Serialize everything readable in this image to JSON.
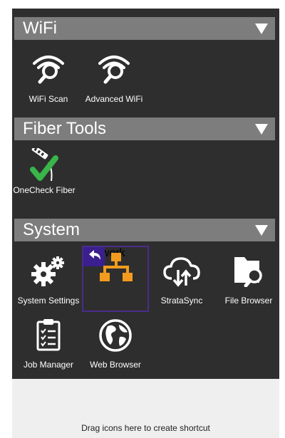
{
  "colors": {
    "background": "#2e2e2e",
    "header": "#7d7d7d",
    "accent_orange": "#f39b1f",
    "accent_purple": "#3b1f8e",
    "check_green": "#39b54a"
  },
  "sections": [
    {
      "title": "WiFi",
      "apps": [
        {
          "label": "WiFi Scan",
          "icon": "wifi-scan-icon"
        },
        {
          "label": "Advanced WiFi",
          "icon": "advanced-wifi-icon"
        }
      ]
    },
    {
      "title": "Fiber Tools",
      "apps": [
        {
          "label": "OneCheck Fiber",
          "icon": "fiber-check-icon"
        }
      ]
    },
    {
      "title": "System",
      "apps": [
        {
          "label": "System Settings",
          "icon": "gears-icon"
        },
        {
          "label": "Network",
          "icon": "network-icon",
          "selected": true
        },
        {
          "label": "StrataSync",
          "icon": "cloud-sync-icon"
        },
        {
          "label": "File Browser",
          "icon": "folder-search-icon"
        },
        {
          "label": "Job Manager",
          "icon": "clipboard-checklist-icon"
        },
        {
          "label": "Web Browser",
          "icon": "globe-icon"
        }
      ]
    }
  ],
  "drop_area": {
    "text": "Drag icons here to create shortcut"
  }
}
